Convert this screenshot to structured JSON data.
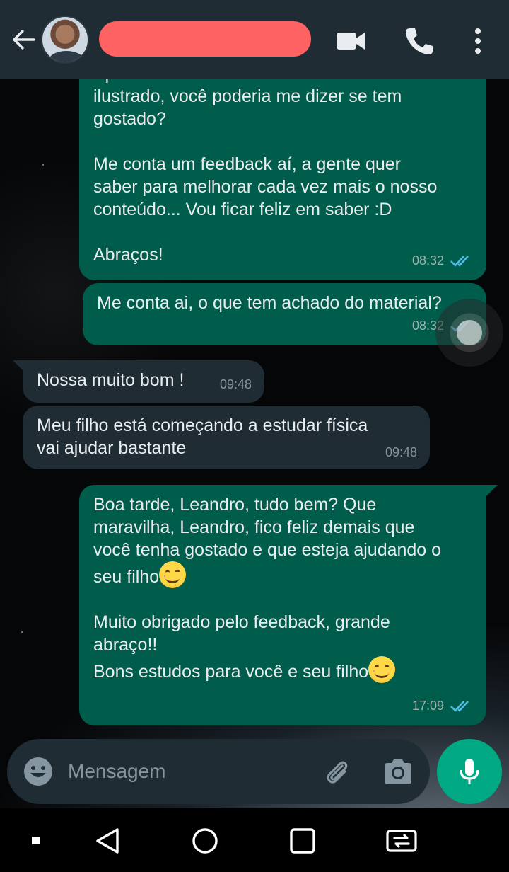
{
  "header": {
    "contact_name": "",
    "avatar_alt": "contact-avatar"
  },
  "messages": [
    {
      "id": "m1",
      "direction": "out",
      "text_partial_top": "Após esses dias de estudo com o material",
      "text": "ilustrado, você poderia me dizer se tem\ngostado?\n\nMe conta um feedback aí, a gente quer\nsaber para melhorar cada vez mais o nosso\nconteúdo... Vou ficar feliz em saber :D\n\nAbraços!",
      "time": "08:32",
      "status": "read"
    },
    {
      "id": "m2",
      "direction": "out",
      "text": "Me conta ai, o que tem achado do material?",
      "time": "08:32",
      "status": "read"
    },
    {
      "id": "m3",
      "direction": "in",
      "text": "Nossa muito bom !",
      "time": "09:48"
    },
    {
      "id": "m4",
      "direction": "in",
      "text": "Meu filho está começando a estudar física\nvai ajudar bastante",
      "time": "09:48"
    },
    {
      "id": "m5",
      "direction": "out",
      "text_a": "Boa tarde, Leandro, tudo bem? Que\nmaravilha, Leandro, fico feliz demais que\nvocê tenha gostado e que esteja ajudando o\nseu filho",
      "text_b": "Muito obrigado pelo feedback, grande\nabraço!!\nBons estudos para você e seu filho",
      "time": "17:09",
      "status": "read"
    }
  ],
  "composer": {
    "placeholder": "Mensagem"
  },
  "colors": {
    "header_bg": "#1f2c34",
    "outgoing_bubble": "#005c4b",
    "incoming_bubble": "#1f2c34",
    "read_ticks": "#53bdeb",
    "mic_button": "#00a884",
    "name_redaction": "#ff6262"
  },
  "icons": {
    "header": [
      "back-arrow-icon",
      "video-call-icon",
      "phone-icon",
      "more-vert-icon"
    ],
    "composer": [
      "emoji-icon",
      "attach-icon",
      "camera-icon",
      "mic-icon"
    ],
    "navbar": [
      "dot-icon",
      "nav-back-icon",
      "nav-home-icon",
      "nav-recents-icon",
      "screen-switch-icon"
    ]
  }
}
